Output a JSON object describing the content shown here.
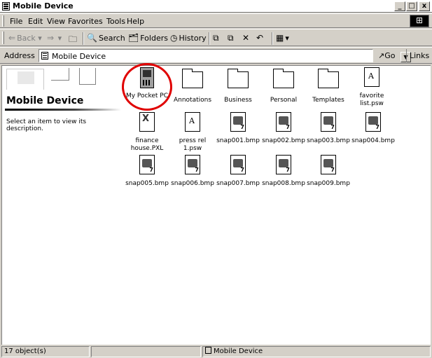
{
  "window": {
    "title": "Mobile Device"
  },
  "title_buttons": {
    "minimize": "_",
    "maximize": "□",
    "close": "x"
  },
  "menu": [
    "File",
    "Edit",
    "View",
    "Favorites",
    "Tools",
    "Help"
  ],
  "toolbar": {
    "back": "Back",
    "search": "Search",
    "folders": "Folders",
    "history": "History"
  },
  "address": {
    "label": "Address",
    "value": "Mobile Device",
    "go": "Go",
    "links": "Links"
  },
  "left_pane": {
    "heading": "Mobile Device",
    "description": "Select an item to view its description."
  },
  "items": [
    {
      "label": "My Pocket PC",
      "icon": "pocket-pc-icon"
    },
    {
      "label": "Annotations",
      "icon": "folder-icon"
    },
    {
      "label": "Business",
      "icon": "folder-icon"
    },
    {
      "label": "Personal",
      "icon": "folder-icon"
    },
    {
      "label": "Templates",
      "icon": "folder-icon"
    },
    {
      "label": "favorite list.psw",
      "icon": "psw-file-icon"
    },
    {
      "label": "finance house.PXL",
      "icon": "pxl-file-icon"
    },
    {
      "label": "press rel 1.psw",
      "icon": "psw-file-icon"
    },
    {
      "label": "snap001.bmp",
      "icon": "bmp-file-icon"
    },
    {
      "label": "snap002.bmp",
      "icon": "bmp-file-icon"
    },
    {
      "label": "snap003.bmp",
      "icon": "bmp-file-icon"
    },
    {
      "label": "snap004.bmp",
      "icon": "bmp-file-icon"
    },
    {
      "label": "snap005.bmp",
      "icon": "bmp-file-icon"
    },
    {
      "label": "snap006.bmp",
      "icon": "bmp-file-icon"
    },
    {
      "label": "snap007.bmp",
      "icon": "bmp-file-icon"
    },
    {
      "label": "snap008.bmp",
      "icon": "bmp-file-icon"
    },
    {
      "label": "snap009.bmp",
      "icon": "bmp-file-icon"
    }
  ],
  "status": {
    "count": "17 object(s)",
    "location": "Mobile Device"
  },
  "colors": {
    "face": "#d4d0c8",
    "highlight_circle": "#e00000",
    "content_bg": "#ffffff"
  }
}
